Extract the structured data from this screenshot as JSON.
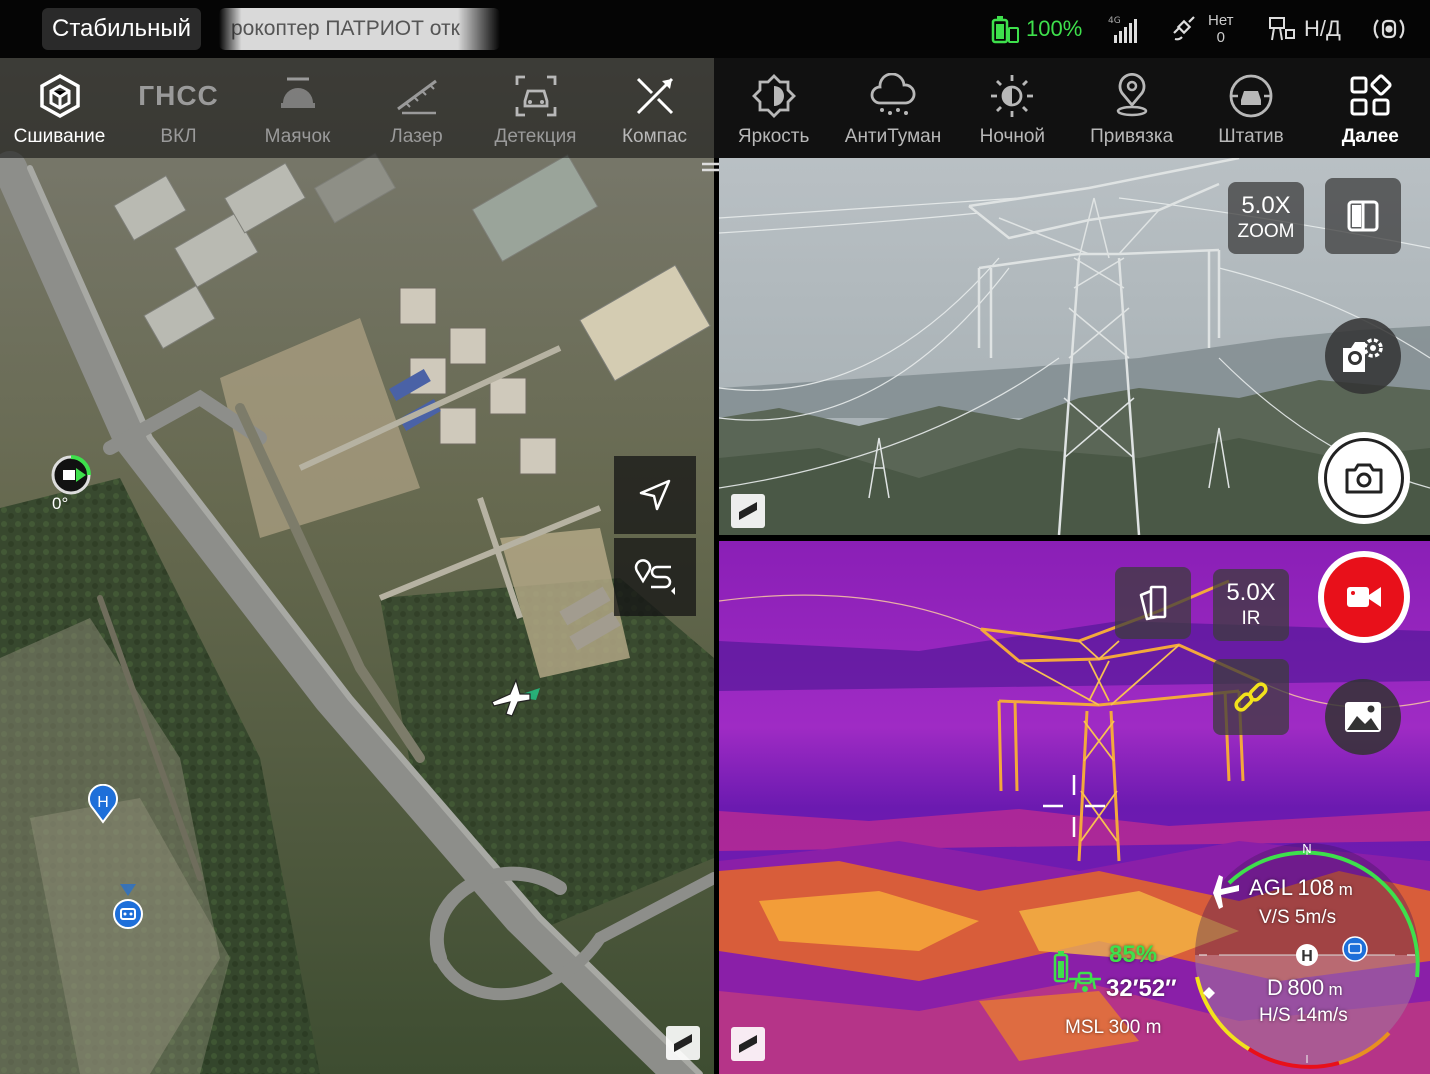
{
  "status_bar": {
    "flight_mode": "Стабильный",
    "drone_message": "рокоптер ПАТРИОТ отк",
    "battery": "100%",
    "signal_label": "4G",
    "satellite_label": "Нет",
    "satellite_count": "0",
    "rtk_status": "Н/Д"
  },
  "toolbar": {
    "left": [
      {
        "label": "Сшивание"
      },
      {
        "label": "ВКЛ",
        "icon_text": "ГНСС"
      },
      {
        "label": "Маячок"
      },
      {
        "label": "Лазер"
      },
      {
        "label": "Детекция"
      },
      {
        "label": "Компас"
      }
    ],
    "right": [
      {
        "label": "Яркость"
      },
      {
        "label": "АнтиТуман"
      },
      {
        "label": "Ночной"
      },
      {
        "label": "Привязка"
      },
      {
        "label": "Штатив"
      },
      {
        "label": "Далее"
      }
    ]
  },
  "map": {
    "heading": "0°",
    "home_marker": "H"
  },
  "camera": {
    "zoom_value": "5.0X",
    "zoom_label": "ZOOM"
  },
  "ir": {
    "zoom_value": "5.0X",
    "zoom_label": "IR"
  },
  "telemetry": {
    "battery": "85%",
    "flight_time": "32′52″",
    "msl_label": "MSL",
    "msl_value": "300",
    "msl_unit": "m",
    "compass_north": "N",
    "agl_label": "AGL",
    "agl_value": "108",
    "agl_unit": "m",
    "vs_label": "V/S",
    "vs_value": "5m/s",
    "home_letter": "H",
    "d_label": "D",
    "d_value": "800",
    "d_unit": "m",
    "hs_label": "H/S",
    "hs_value": "14m/s"
  },
  "colors": {
    "accent_green": "#3ee04c",
    "record_red": "#e8101a",
    "marker_blue": "#1e6fd9"
  }
}
